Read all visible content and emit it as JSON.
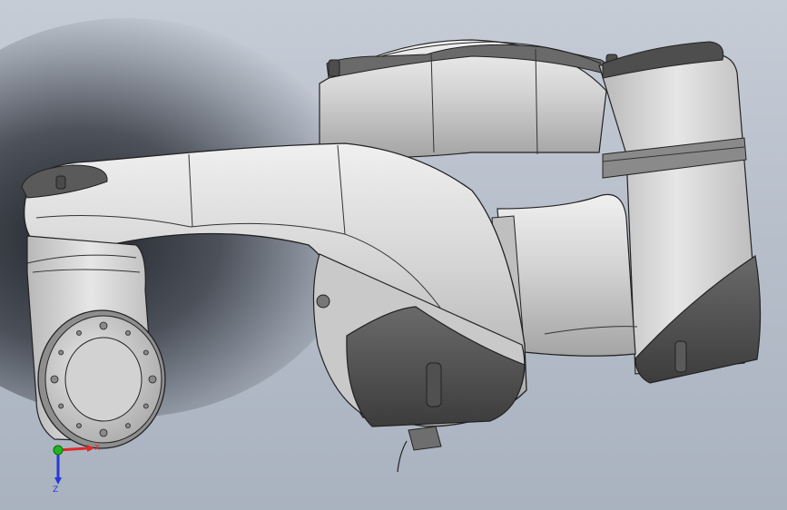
{
  "viewport": {
    "background_top": "#c6ccd6",
    "background_bottom": "#a9b2bf",
    "shadow_color": "#1c1f25"
  },
  "model": {
    "body_color": "#d4d4d4",
    "highlight_color": "#eeeeee",
    "shade_color": "#9a9a9a",
    "dark_cap_color": "#555555",
    "edge_color": "#222222"
  },
  "triad": {
    "x_label": "X",
    "z_label": "Z",
    "x_color": "#e0282a",
    "y_color": "#1fb51f",
    "z_color": "#2838d8"
  }
}
